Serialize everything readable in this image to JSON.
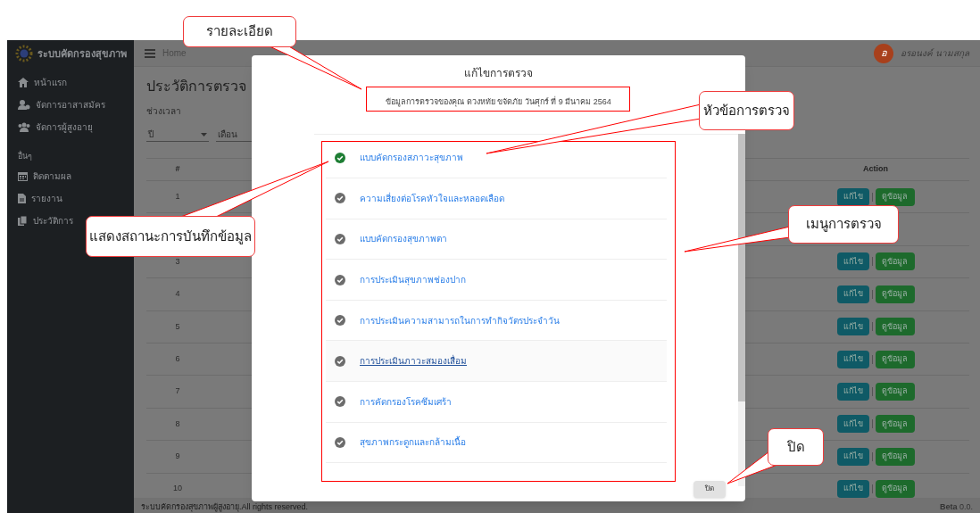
{
  "sidebar": {
    "brand": "ระบบคัดกรองสุขภาพ",
    "items": [
      {
        "label": "หน้าแรก"
      },
      {
        "label": "จัดการอาสาสมัคร"
      },
      {
        "label": "จัดการผู้สูงอายุ"
      }
    ],
    "section_label": "อื่นๆ",
    "section_items": [
      {
        "label": "ติดตามผล"
      },
      {
        "label": "รายงาน"
      },
      {
        "label": "ประวัติการ"
      }
    ]
  },
  "header": {
    "breadcrumb": "Home",
    "avatar_letter": "อ",
    "user_name": "อรอนงค์ นามสกุล"
  },
  "page": {
    "title": "ประวัติการตรวจ",
    "period_label": "ช่วงเวลา",
    "selects": [
      {
        "value": "ปี"
      },
      {
        "value": "เดือน"
      }
    ],
    "table": {
      "columns": [
        "#",
        "Action"
      ],
      "rows": [
        {
          "number": "1",
          "actions": [
            "แก้ไข",
            "ดูข้อมูล"
          ]
        },
        {
          "actions": []
        },
        {
          "number": "3",
          "actions": [
            "แก้ไข",
            "ดูข้อมูล"
          ]
        },
        {
          "number": "4",
          "actions": [
            "แก้ไข",
            "ดูข้อมูล"
          ]
        },
        {
          "number": "5",
          "actions": [
            "แก้ไข",
            "ดูข้อมูล"
          ]
        },
        {
          "number": "6",
          "actions": [
            "แก้ไข",
            "ดูข้อมูล"
          ]
        },
        {
          "number": "7",
          "actions": [
            "แก้ไข",
            "ดูข้อมูล"
          ]
        },
        {
          "number": "8",
          "actions": [
            "แก้ไข",
            "ดูข้อมูล"
          ]
        },
        {
          "number": "9",
          "actions": [
            "แก้ไข",
            "ดูข้อมูล"
          ]
        },
        {
          "number": "10",
          "actions": [
            "แก้ไข",
            "ดูข้อมูล"
          ]
        }
      ]
    }
  },
  "footer": {
    "text": "ระบบคัดกรองสุขภาพผู้สูงอายุ.All rights reserved.",
    "version_label": "Beta",
    "version": "0.0."
  },
  "modal": {
    "title": "แก้ไขการตรวจ",
    "info": "ข้อมูลการตรวจของคุณ ดวงหทัย ขจัดภัย วันศุกร์ ที่ 9 มีนาคม 2564",
    "items": [
      {
        "label": "แบบคัดกรองสภาวะสุขภาพ",
        "done": true,
        "hovered": false
      },
      {
        "label": "ความเสี่ยงต่อโรคหัวใจและหลอดเลือด",
        "done": false,
        "hovered": false
      },
      {
        "label": "แบบคัดกรองสุขภาพตา",
        "done": false,
        "hovered": false
      },
      {
        "label": "การประเมินสุขภาพช่องปาก",
        "done": false,
        "hovered": false
      },
      {
        "label": "การประเมินความสามารถในการทำกิจวัตรประจำวัน",
        "done": false,
        "hovered": false
      },
      {
        "label": "การประเมินภาวะสมองเสื่อม",
        "done": false,
        "hovered": true
      },
      {
        "label": "การคัดกรองโรคซึมเศร้า",
        "done": false,
        "hovered": false
      },
      {
        "label": "สุขภาพกระดูกและกล้ามเนื้อ",
        "done": false,
        "hovered": false
      }
    ],
    "close_button": "ปิด"
  },
  "annotations": [
    {
      "text": "รายละเอียด"
    },
    {
      "text": "หัวข้อการตรวจ"
    },
    {
      "text": "แสดงสถานะการบันทึกข้อมูล"
    },
    {
      "text": "เมนูการตรวจ"
    },
    {
      "text": "ปิด"
    }
  ]
}
